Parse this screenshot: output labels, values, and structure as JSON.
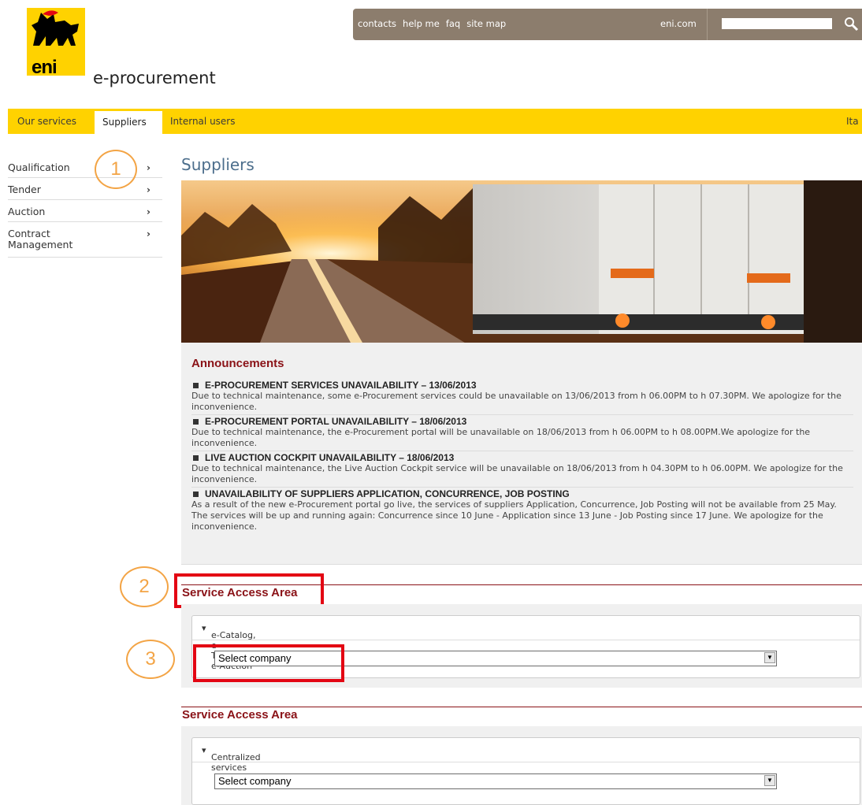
{
  "header": {
    "logo_text": "eni",
    "site_name": "e-procurement",
    "top_links": [
      "contacts",
      "help me",
      "faq",
      "site map"
    ],
    "eni_link": "eni.com",
    "search": {
      "value": "",
      "icon": "search-icon"
    }
  },
  "nav": {
    "items": [
      "Our services",
      "Suppliers",
      "Internal users"
    ],
    "active": "Suppliers",
    "language": "Ita"
  },
  "sidebar": {
    "items": [
      {
        "label": "Qualification"
      },
      {
        "label": "Tender"
      },
      {
        "label": "Auction"
      },
      {
        "label": "Contract Management"
      }
    ],
    "chevron_icon": "chevron-right-icon"
  },
  "markers": [
    "1",
    "2",
    "3"
  ],
  "main": {
    "title": "Suppliers",
    "announcements": {
      "title": "Announcements",
      "items": [
        {
          "heading": "E-PROCUREMENT SERVICES UNAVAILABILITY – 13/06/2013",
          "body": "Due to technical maintenance, some e-Procurement services could be unavailable on 13/06/2013 from h 06.00PM to h 07.30PM. We apologize for the inconvenience."
        },
        {
          "heading": "E-PROCUREMENT PORTAL UNAVAILABILITY – 18/06/2013",
          "body": "Due to technical maintenance, the e-Procurement portal will be unavailable on 18/06/2013 from h 06.00PM to h 08.00PM.We apologize for the inconvenience."
        },
        {
          "heading": "LIVE AUCTION COCKPIT UNAVAILABILITY – 18/06/2013",
          "body": "Due to technical maintenance, the Live Auction Cockpit service will be unavailable on 18/06/2013 from h 04.30PM to h 06.00PM. We apologize for the inconvenience."
        },
        {
          "heading": "UNAVAILABILITY OF SUPPLIERS APPLICATION, CONCURRENCE, JOB POSTING",
          "body": "As a result of the new e-Procurement portal go live, the services of suppliers Application, Concurrence, Job Posting will not be available from 25 May. The services will be up and running again: Concurrence since 10 June - Application since 13 June - Job Posting since 17 June. We apologize for the inconvenience."
        }
      ]
    },
    "access_areas": [
      {
        "title": "Service Access Area",
        "panel_title": "e-Catalog, e-Tendering, e-Auction",
        "select_value": "Select company"
      },
      {
        "title": "Service Access Area",
        "panel_title": "Centralized services",
        "select_value": "Select company"
      }
    ]
  },
  "colors": {
    "brand_yellow": "#ffd200",
    "topbar_brown": "#8c7d6d",
    "section_red": "#8a1217",
    "title_blue": "#4c6e8c",
    "marker_orange": "#f3a445",
    "highlight_red": "#e30613"
  }
}
